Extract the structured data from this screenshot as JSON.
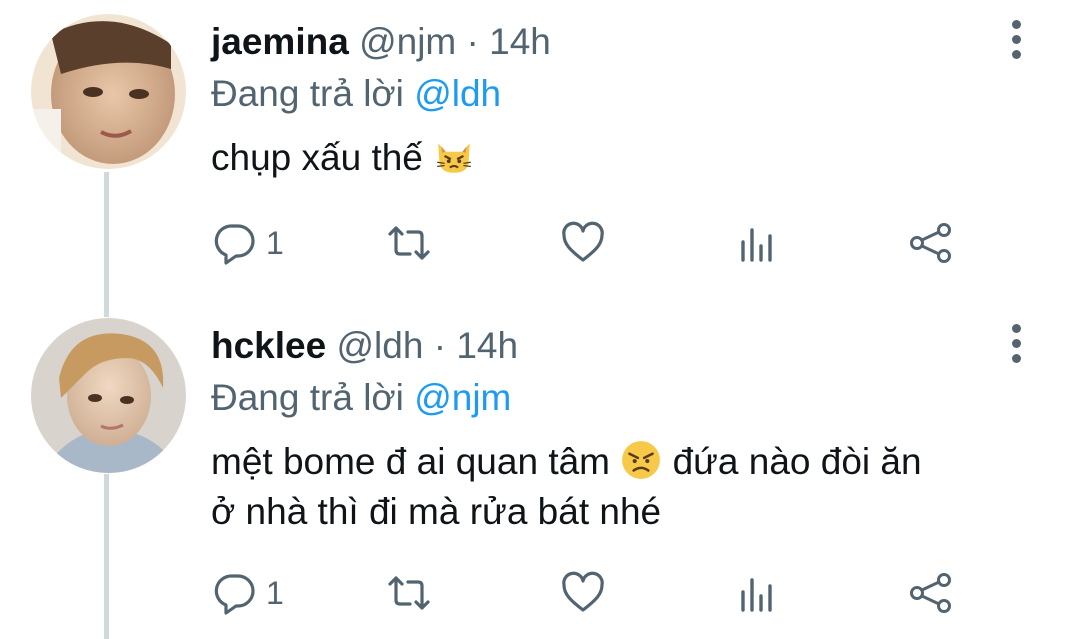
{
  "tweets": [
    {
      "display_name": "jaemina",
      "handle": "@njm",
      "separator": "·",
      "time": "14h",
      "reply_prefix": "Đang trả lời",
      "reply_to": "@ldh",
      "body": "chụp xấu thế",
      "body_emoji": "pouting-cat-emoji",
      "reply_count": "1"
    },
    {
      "display_name": "hcklee",
      "handle": "@ldh",
      "separator": "·",
      "time": "14h",
      "reply_prefix": "Đang trả lời",
      "reply_to": "@njm",
      "body_line1_a": "mệt bome đ ai quan tâm",
      "body_emoji": "angry-face-emoji",
      "body_line1_b": "đứa nào đòi ăn",
      "body_line2": "ở nhà thì đi mà rửa bát nhé",
      "reply_count": "1"
    }
  ],
  "colors": {
    "text": "#0f1419",
    "secondary": "#536471",
    "link": "#1d9bf0",
    "thread_line": "#cfd9de"
  },
  "icons": [
    "reply-icon",
    "retweet-icon",
    "like-icon",
    "analytics-icon",
    "share-icon",
    "more-icon"
  ]
}
